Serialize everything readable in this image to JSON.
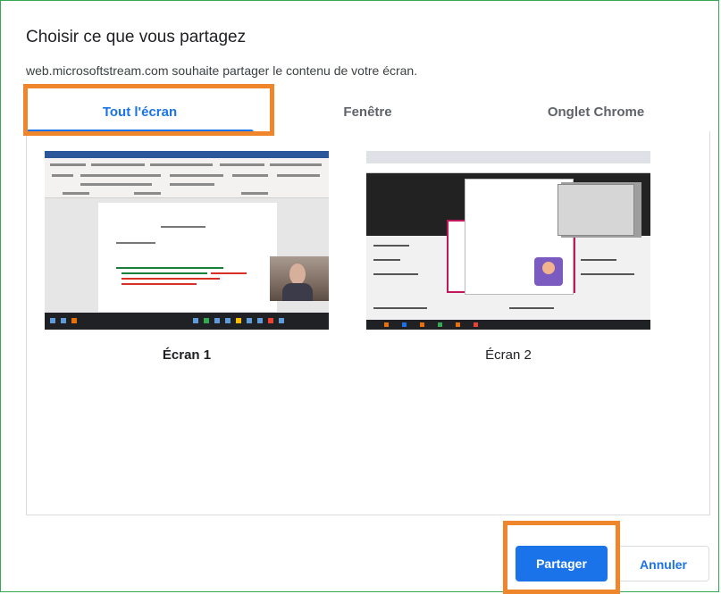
{
  "dialog": {
    "title": "Choisir ce que vous partagez",
    "subtitle": "web.microsoftstream.com souhaite partager le contenu de votre écran."
  },
  "tabs": [
    {
      "label": "Tout l'écran",
      "active": true
    },
    {
      "label": "Fenêtre",
      "active": false
    },
    {
      "label": "Onglet Chrome",
      "active": false
    }
  ],
  "sources": [
    {
      "label": "Écran 1",
      "selected": true
    },
    {
      "label": "Écran 2",
      "selected": false
    }
  ],
  "buttons": {
    "share": "Partager",
    "cancel": "Annuler"
  },
  "colors": {
    "accent": "#1a73e8",
    "highlight": "#f0862b",
    "frame": "#34a853"
  }
}
